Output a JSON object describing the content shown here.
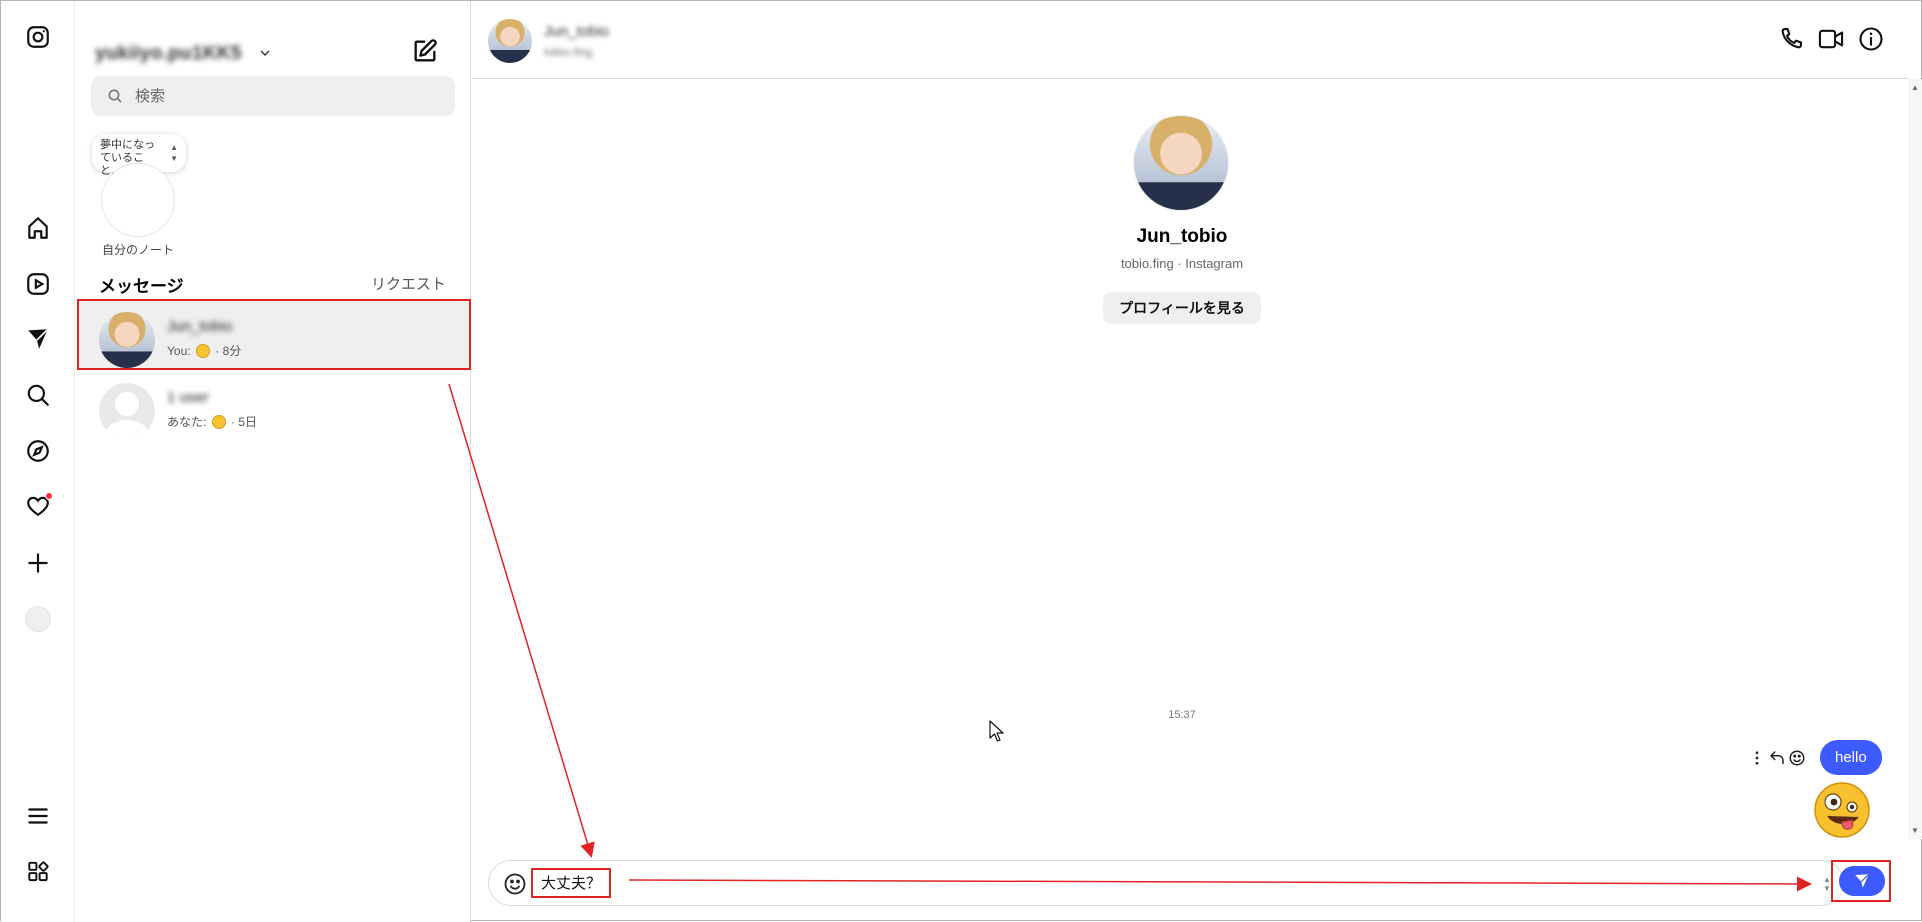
{
  "app": {
    "name": "Instagram"
  },
  "rail": {
    "icons": [
      "instagram-logo",
      "home-icon",
      "reels-icon",
      "messages-icon",
      "search-icon",
      "explore-icon",
      "heart-icon",
      "create-icon",
      "profile-avatar",
      "menu-icon",
      "more-icon"
    ]
  },
  "inbox": {
    "account_name": "yukiiyo.pu1KK5",
    "search_placeholder": "検索",
    "note": {
      "bubble_text": "夢中になっていること...",
      "caption": "自分のノート"
    },
    "messages_title": "メッセージ",
    "requests_label": "リクエスト",
    "threads": [
      {
        "name": "Jun_tobio",
        "preview_prefix": "You:",
        "preview_suffix": "· 8分",
        "active": true
      },
      {
        "name": "1 user",
        "preview_prefix": "あなた:",
        "preview_suffix": "· 5日",
        "active": false
      }
    ]
  },
  "chat": {
    "header_name": "Jun_tobio",
    "header_sub": "tobio.fing",
    "profile_name": "Jun_tobio",
    "profile_sub": "tobio.fing · Instagram",
    "profile_button": "プロフィールを見る",
    "time_label": "15:37",
    "message_text": "hello",
    "composer_text": "大丈夫？"
  },
  "colors": {
    "accent": "#3d5afe",
    "annotation": "#e02323",
    "notification": "#ff3040"
  }
}
